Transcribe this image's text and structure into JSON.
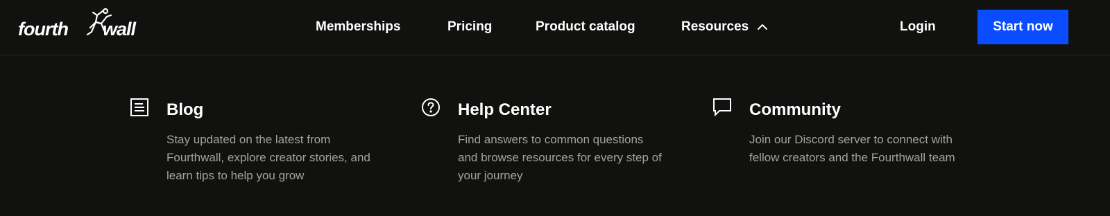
{
  "header": {
    "logo_left": "fourth",
    "logo_right": "wall",
    "nav": {
      "memberships": "Memberships",
      "pricing": "Pricing",
      "product_catalog": "Product catalog",
      "resources": "Resources"
    },
    "resources_expanded": true,
    "login": "Login",
    "cta": "Start now"
  },
  "resources_menu": {
    "items": [
      {
        "icon": "article-icon",
        "title": "Blog",
        "description": "Stay updated on the latest from Fourthwall, explore creator stories, and learn tips to help you grow"
      },
      {
        "icon": "question-circle-icon",
        "title": "Help Center",
        "description": "Find answers to common questions and browse resources for every step of your journey"
      },
      {
        "icon": "chat-bubble-icon",
        "title": "Community",
        "description": "Join our Discord server to connect with fellow creators and the Fourthwall team"
      }
    ]
  },
  "colors": {
    "background": "#111210",
    "accent": "#0a4cff",
    "text": "#ffffff",
    "muted_text": "#a3a39c",
    "divider": "#2a2b28"
  }
}
